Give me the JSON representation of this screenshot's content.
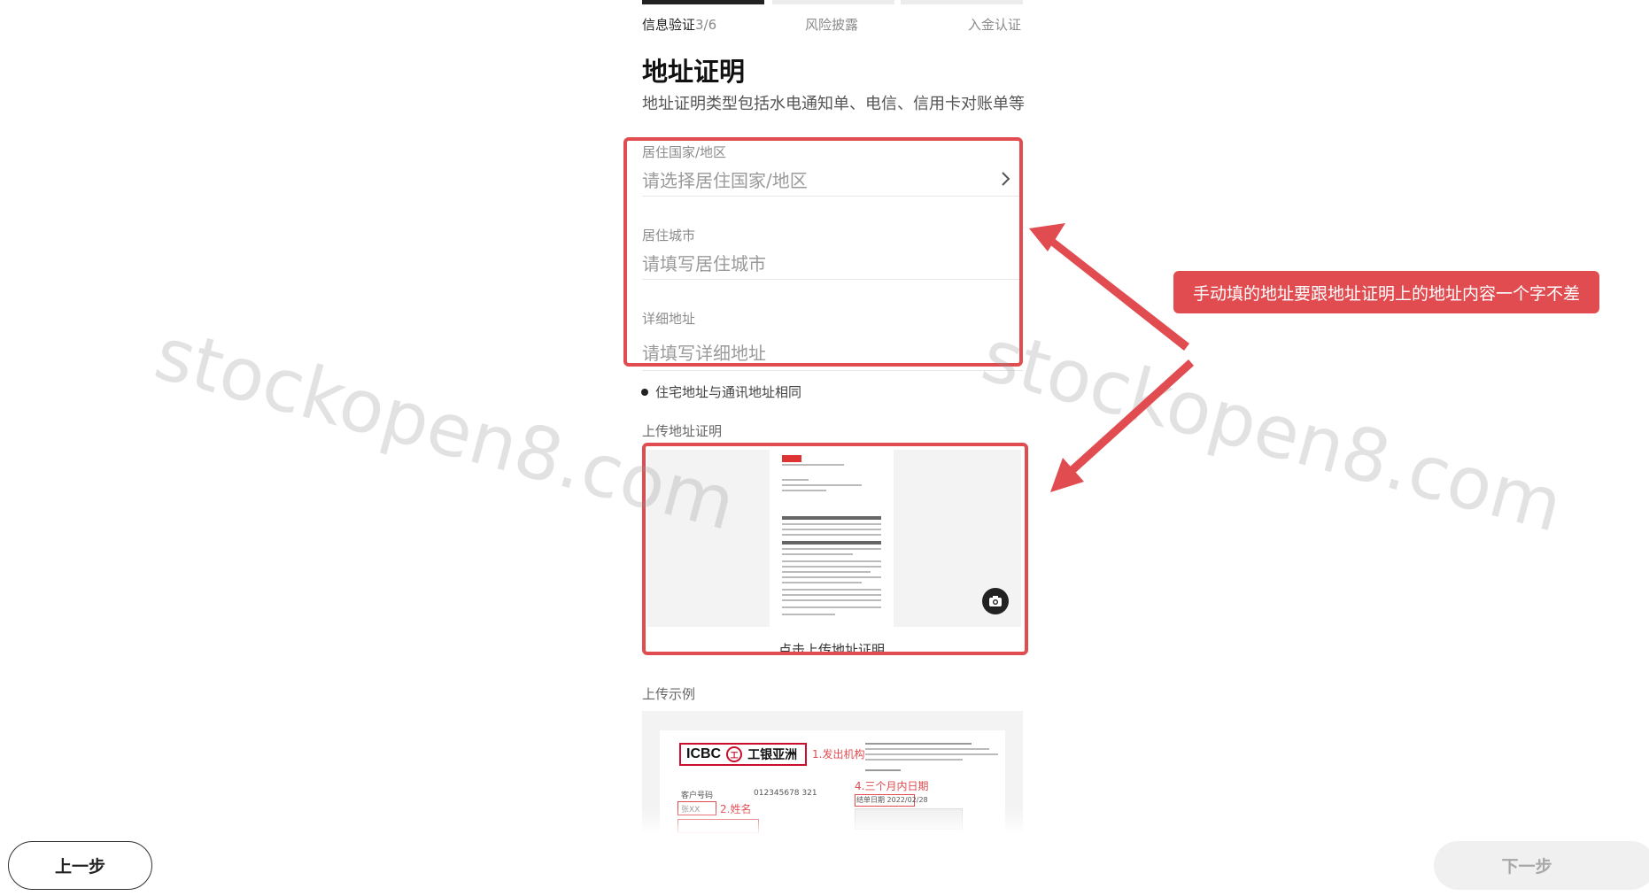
{
  "progress": {
    "steps": [
      {
        "label": "信息验证",
        "counter": "3/6",
        "active": true
      },
      {
        "label": "风险披露",
        "active": false
      },
      {
        "label": "入金认证",
        "active": false
      }
    ],
    "current_segment_fill": 1.0
  },
  "page": {
    "title": "地址证明",
    "subtitle": "地址证明类型包括水电通知单、电信、信用卡对账单等"
  },
  "form": {
    "country": {
      "label": "居住国家/地区",
      "placeholder": "请选择居住国家/地区"
    },
    "city": {
      "label": "居住城市",
      "placeholder": "请填写居住城市"
    },
    "address": {
      "label": "详细地址",
      "placeholder": "请填写详细地址"
    },
    "same_address": "住宅地址与通讯地址相同"
  },
  "upload": {
    "section_label": "上传地址证明",
    "caption": "点击上传地址证明"
  },
  "example": {
    "section_label": "上传示例",
    "icbc_en": "ICBC",
    "icbc_cn": "工银亚洲",
    "tag_issuer": "1.发出机构",
    "tag_date": "4.三个月内日期",
    "tag_name": "2.姓名",
    "customer_no_label": "客户号码",
    "customer_no": "012345678 321",
    "name_value": "张XX",
    "date_value": "结单日期 2022/02/28"
  },
  "buttons": {
    "prev": "上一步",
    "next": "下一步"
  },
  "annotation": {
    "text": "手动填的地址要跟地址证明上的地址内容一个字不差"
  },
  "watermark": "stockopen8.com",
  "colors": {
    "annotation_red": "#e04c50",
    "brand_red": "#c8102e"
  }
}
